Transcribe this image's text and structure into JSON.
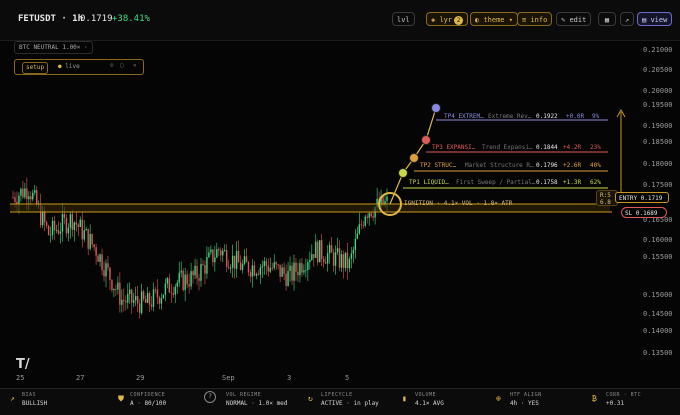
{
  "header": {
    "symbol": "FETUSDT · 1h",
    "price": "0.1719",
    "change": "+38.41%",
    "buttons": {
      "lvl": "lvl",
      "lyr": "lyr",
      "lyr_badge": "2",
      "theme": "theme ▾",
      "info": "info",
      "edit": "edit",
      "view": "view"
    }
  },
  "overlay": {
    "btc_chip": "BTC  NEUTRAL  1.00×  ·",
    "setup_label": "setup",
    "live_label": "live"
  },
  "y_axis": [
    "0.21000",
    "0.20500",
    "0.20000",
    "0.19500",
    "0.19000",
    "0.18500",
    "0.18000",
    "0.17500",
    "0.16500",
    "0.16000",
    "0.15500",
    "0.15000",
    "0.14500",
    "0.14000",
    "0.13500"
  ],
  "x_axis": [
    "25",
    "27",
    "29",
    "Sep",
    "3",
    "5"
  ],
  "targets": [
    {
      "tag": "TP4",
      "name": "TP4 EXTREM…",
      "desc": "Extreme Rev…",
      "price": "0.1922",
      "pct": "+0.0R",
      "prob": "9%",
      "color": "#8a8ae0"
    },
    {
      "tag": "TP3",
      "name": "TP3 EXPANSI…",
      "desc": "Trend Expansi…",
      "price": "0.1844",
      "pct": "+4.2R",
      "prob": "23%",
      "color": "#e05a5a"
    },
    {
      "tag": "TP2",
      "name": "TP2 STRUC…",
      "desc": "Market Structure R…",
      "price": "0.1796",
      "pct": "+2.6R",
      "prob": "40%",
      "color": "#e0a040"
    },
    {
      "tag": "TP1",
      "name": "TP1 LIQUID…",
      "desc": "First Sweep / Partial…",
      "price": "0.1758",
      "pct": "+1.3R",
      "prob": "62%",
      "color": "#c8d84a"
    }
  ],
  "ignition": "IGNITION · 4.1× VOL · 1.8× ATR",
  "entry": {
    "label": "ENTRY",
    "price": "0.1719"
  },
  "rr": {
    "line1": "R:5",
    "line2": "6.8"
  },
  "stop": {
    "label": "SL",
    "price": "0.1689"
  },
  "stats": [
    {
      "icon": "trend-icon",
      "label": "BIAS",
      "value": "BULLISH"
    },
    {
      "icon": "shield-icon",
      "label": "CONFIDENCE",
      "value": "A · 80/100"
    },
    {
      "icon": "help-icon",
      "label": "VOL REGIME",
      "value": "NORMAL · 1.0× med"
    },
    {
      "icon": "cycle-icon",
      "label": "LIFECYCLE",
      "value": "ACTIVE · in play"
    },
    {
      "icon": "volume-icon",
      "label": "VOLUME",
      "value": "4.1× AVG"
    },
    {
      "icon": "align-icon",
      "label": "HTF ALIGN",
      "value": "4h · YES"
    },
    {
      "icon": "bitcoin-icon",
      "label": "CORR · BTC",
      "value": "+0.31"
    }
  ],
  "chart_data": {
    "type": "candlestick",
    "y_range": [
      0.1325,
      0.212
    ],
    "price_start": 0.1735,
    "price_end": 0.1719,
    "low": 0.143,
    "entry": 0.1719,
    "stop": 0.1689,
    "targets": [
      0.1758,
      0.1796,
      0.1844,
      0.1922
    ]
  }
}
